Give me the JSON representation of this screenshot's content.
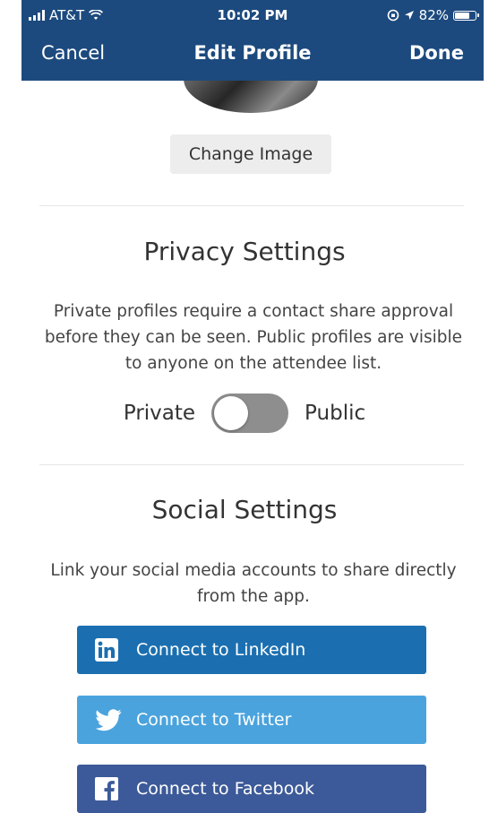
{
  "status_bar": {
    "carrier": "AT&T",
    "time": "10:02 PM",
    "battery_percent": "82%",
    "battery_level": 0.82
  },
  "nav": {
    "cancel_label": "Cancel",
    "title": "Edit Profile",
    "done_label": "Done"
  },
  "profile": {
    "change_image_label": "Change Image"
  },
  "privacy": {
    "title": "Privacy Settings",
    "description": "Private profiles require a contact share approval before they can be seen. Public profiles are visible to anyone on the attendee list.",
    "private_label": "Private",
    "public_label": "Public",
    "toggle_state": "off"
  },
  "social": {
    "title": "Social Settings",
    "description": "Link your social media accounts to share directly from the app.",
    "buttons": [
      {
        "label": "Connect to LinkedIn",
        "icon": "linkedin-icon",
        "color": "#1b6fb0"
      },
      {
        "label": "Connect to Twitter",
        "icon": "twitter-icon",
        "color": "#4aa3dd"
      },
      {
        "label": "Connect to Facebook",
        "icon": "facebook-icon",
        "color": "#3c5a99"
      }
    ]
  },
  "colors": {
    "header_bg": "#1c4a7e",
    "button_bg": "#ededed",
    "toggle_bg": "#8e8e8e"
  }
}
